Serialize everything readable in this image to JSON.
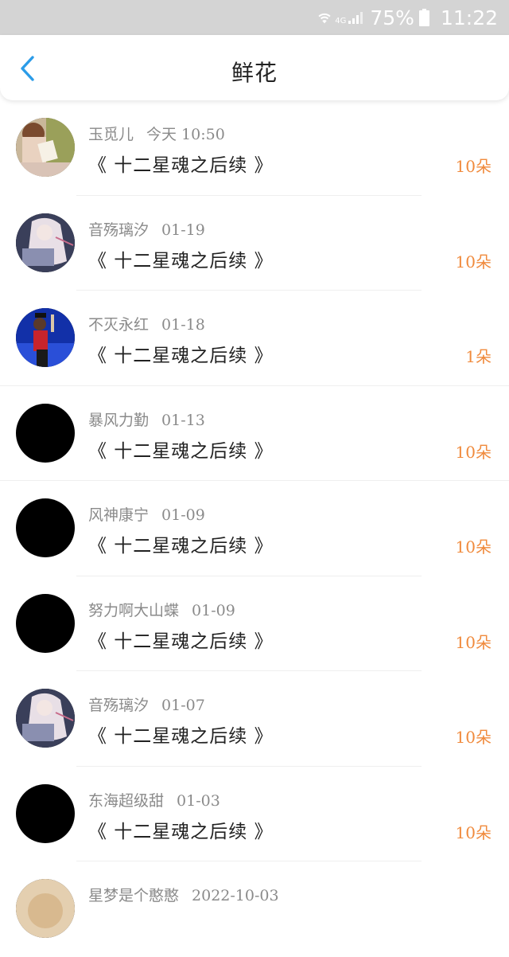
{
  "status_bar": {
    "network": "4G",
    "battery": "75%",
    "time": "11:22"
  },
  "header": {
    "title": "鲜花",
    "back_icon": "chevron-left-icon",
    "accent_color": "#2b9ce8"
  },
  "colors": {
    "count": "#f08a3c",
    "meta": "#8a8a8a",
    "book": "#222222"
  },
  "gifts": [
    {
      "user": "玉觅儿",
      "date": "今天 10:50",
      "book": "《 十二星魂之后续 》",
      "count": "10朵",
      "avatar": "photo-reading-girl"
    },
    {
      "user": "音殇璃汐",
      "date": "01-19",
      "book": "《 十二星魂之后续 》",
      "count": "10朵",
      "avatar": "anime-white-hair"
    },
    {
      "user": "不灭永红",
      "date": "01-18",
      "book": "《 十二星魂之后续 》",
      "count": "1朵",
      "avatar": "stage-performer"
    },
    {
      "user": "暴风力勤",
      "date": "01-13",
      "book": "《 十二星魂之后续 》",
      "count": "10朵",
      "avatar": "black"
    },
    {
      "user": "风神康宁",
      "date": "01-09",
      "book": "《 十二星魂之后续 》",
      "count": "10朵",
      "avatar": "black"
    },
    {
      "user": "努力啊大山蝶",
      "date": "01-09",
      "book": "《 十二星魂之后续 》",
      "count": "10朵",
      "avatar": "black"
    },
    {
      "user": "音殇璃汐",
      "date": "01-07",
      "book": "《 十二星魂之后续 》",
      "count": "10朵",
      "avatar": "anime-white-hair"
    },
    {
      "user": "东海超级甜",
      "date": "01-03",
      "book": "《 十二星魂之后续 》",
      "count": "10朵",
      "avatar": "black"
    },
    {
      "user": "星梦是个憨憨",
      "date": "2022-10-03",
      "book": "",
      "count": "",
      "avatar": "photo-beige"
    }
  ]
}
